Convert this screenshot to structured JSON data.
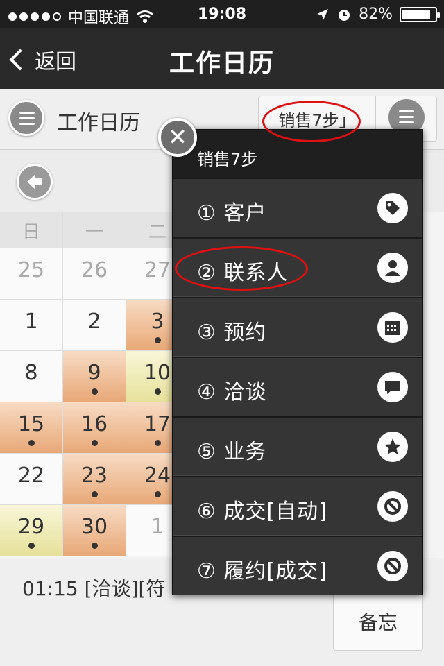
{
  "status": {
    "carrier": "中国联通",
    "time": "19:08",
    "battery": "82%"
  },
  "nav": {
    "back_label": "返回",
    "title": "工作日历"
  },
  "toolbar": {
    "title": "工作日历",
    "sales_label": "销售7步」"
  },
  "calendar": {
    "weekdays": [
      "日",
      "一",
      "二"
    ],
    "rows": [
      [
        {
          "d": "25",
          "s": "gray"
        },
        {
          "d": "26",
          "s": "gray"
        },
        {
          "d": "27",
          "s": "gray"
        }
      ],
      [
        {
          "d": "1",
          "s": "plain"
        },
        {
          "d": "2",
          "s": "plain"
        },
        {
          "d": "3",
          "s": "orange",
          "m": true
        }
      ],
      [
        {
          "d": "8",
          "s": "plain"
        },
        {
          "d": "9",
          "s": "orange",
          "m": true
        },
        {
          "d": "10",
          "s": "yellow",
          "m": true
        }
      ],
      [
        {
          "d": "15",
          "s": "orange",
          "m": true
        },
        {
          "d": "16",
          "s": "orange",
          "m": true
        },
        {
          "d": "17",
          "s": "orange",
          "m": true
        }
      ],
      [
        {
          "d": "22",
          "s": "plain"
        },
        {
          "d": "23",
          "s": "orange",
          "m": true
        },
        {
          "d": "24",
          "s": "orange",
          "m": true
        }
      ],
      [
        {
          "d": "29",
          "s": "yellow",
          "m": true
        },
        {
          "d": "30",
          "s": "orange",
          "m": true
        },
        {
          "d": "1",
          "s": "gray"
        }
      ]
    ]
  },
  "event_preview": "01:15 [洽谈][符",
  "memo_label": "备忘",
  "dialog": {
    "title": "销售7步",
    "items": [
      {
        "label": "① 客户",
        "icon": "tag-icon"
      },
      {
        "label": "② 联系人",
        "icon": "person-icon"
      },
      {
        "label": "③ 预约",
        "icon": "calendar-icon"
      },
      {
        "label": "④ 洽谈",
        "icon": "speech-bubble-icon"
      },
      {
        "label": "⑤ 业务",
        "icon": "star-icon"
      },
      {
        "label": "⑥ 成交[自动]",
        "icon": "prohibited-icon"
      },
      {
        "label": "⑦ 履约[成交]",
        "icon": "prohibited-icon"
      }
    ]
  },
  "colors": {
    "annotation": "#dd1111",
    "orange_cell": "#e8a877",
    "yellow_cell": "#e6e19a"
  }
}
